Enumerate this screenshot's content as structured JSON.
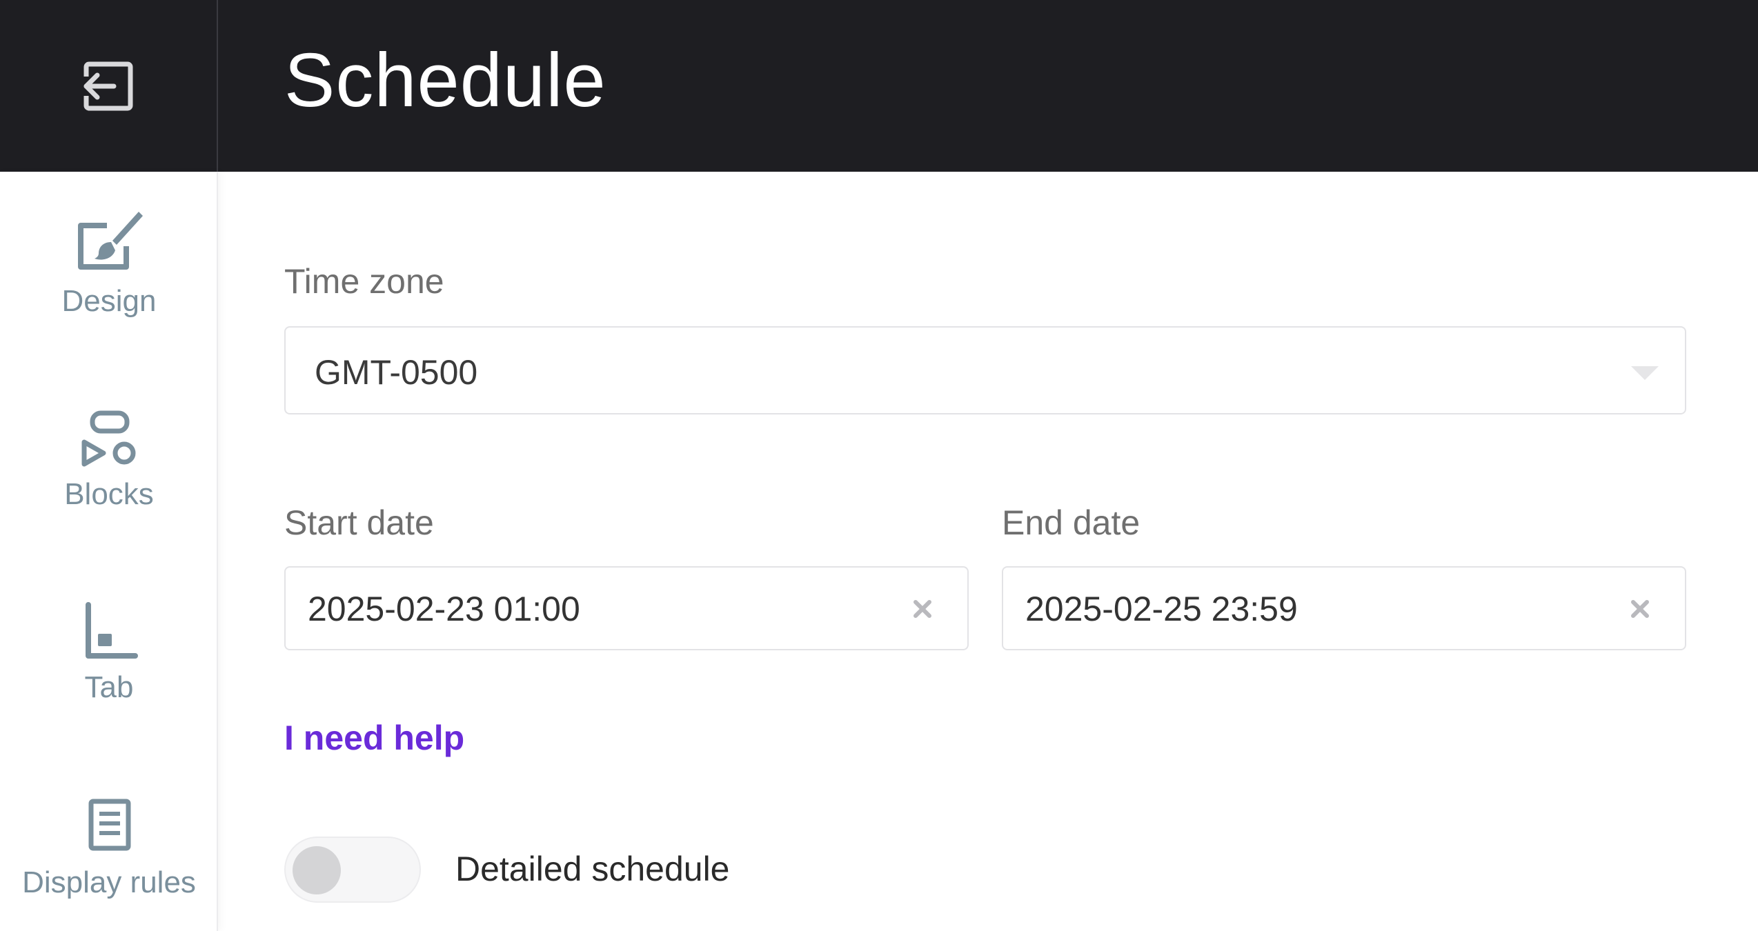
{
  "header": {
    "title": "Schedule",
    "exit_icon": "exit-arrow-icon"
  },
  "sidebar": {
    "items": [
      {
        "label": "Design",
        "icon": "paintbrush-icon"
      },
      {
        "label": "Blocks",
        "icon": "blocks-icon"
      },
      {
        "label": "Tab",
        "icon": "tab-icon"
      },
      {
        "label": "Display rules",
        "icon": "document-list-icon"
      }
    ]
  },
  "form": {
    "timezone": {
      "label": "Time zone",
      "value": "GMT-0500"
    },
    "start_date": {
      "label": "Start date",
      "value": "2025-02-23 01:00"
    },
    "end_date": {
      "label": "End date",
      "value": "2025-02-25 23:59"
    },
    "help_link": "I need help",
    "detailed_schedule": {
      "label": "Detailed schedule",
      "enabled": false
    }
  },
  "colors": {
    "header_bg": "#1e1e22",
    "accent": "#6a2bd9",
    "sidebar_text": "#7a8f9c"
  }
}
